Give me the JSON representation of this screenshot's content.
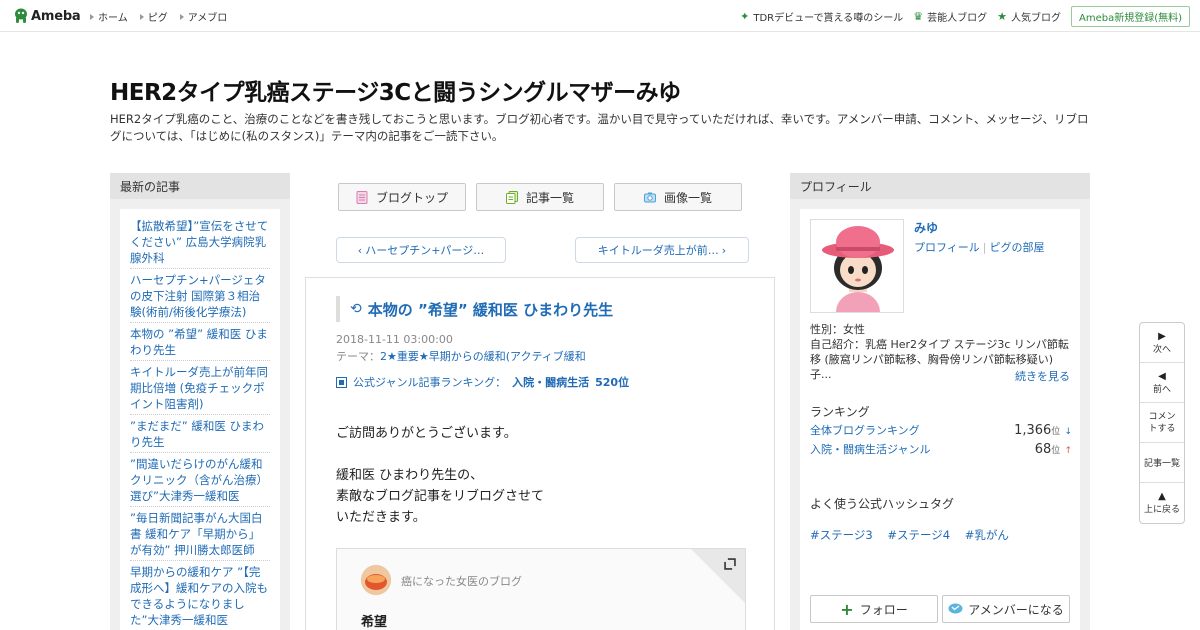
{
  "topbar": {
    "logo_text": "Ameba",
    "nav": [
      "ホーム",
      "ピグ",
      "アメブロ"
    ],
    "links": [
      {
        "label": "TDRデビューで貰える噂のシール",
        "icon": "sparkle-icon"
      },
      {
        "label": "芸能人ブログ",
        "icon": "crown-icon"
      },
      {
        "label": "人気ブログ",
        "icon": "star-icon"
      }
    ],
    "signup": "Ameba新規登録(無料)"
  },
  "header": {
    "title": "HER2タイプ乳癌ステージ3Cと闘うシングルマザーみゆ",
    "description": "HER2タイプ乳癌のこと、治療のことなどを書き残しておこうと思います。ブログ初心者です。温かい目で見守っていただければ、幸いです。アメンバー申請、コメント、メッセージ、リブログについては、「はじめに(私のスタンス)」テーマ内の記事をご一読下さい。"
  },
  "recent": {
    "heading": "最新の記事",
    "items": [
      "【拡散希望】”宣伝をさせてください” 広島大学病院乳腺外科",
      "ハーセプチン+パージェタの皮下注射 国際第３相治験(術前/術後化学療法)",
      "本物の ”希望” 緩和医 ひまわり先生",
      "キイトルーダ売上が前年同期比倍増 (免疫チェックポイント阻害剤)",
      "”まだまだ” 緩和医 ひまわり先生",
      "”間違いだらけのがん緩和クリニック（含がん治療）選び”大津秀一緩和医",
      "”毎日新聞記事がん大国白書 緩和ケア「早期から」が有効” 押川勝太郎医師",
      "早期からの緩和ケア ”【完成形へ】緩和ケアの入院もできるようになりました”大津秀一緩和医"
    ]
  },
  "tabs": {
    "top": "ブログトップ",
    "list": "記事一覧",
    "images": "画像一覧"
  },
  "pager": {
    "prev": "ハーセプチン+パージ…",
    "next": "キイトルーダ売上が前…"
  },
  "article": {
    "title": "本物の ”希望” 緩和医 ひまわり先生",
    "date": "2018-11-11 03:00:00",
    "theme_label": "テーマ：",
    "theme": "2★重要★早期からの緩和(アクティブ緩和",
    "rank_label": "公式ジャンル記事ランキング：",
    "rank_genre": "入院・闘病生活",
    "rank_value": "520位",
    "body": [
      "ご訪問ありがとうございます。",
      "",
      "緩和医 ひまわり先生の、",
      "素敵なブログ記事をリブログさせて",
      "いただきます。"
    ],
    "embed_blog": "癌になった女医のブログ",
    "embed_title": "希望"
  },
  "profile": {
    "heading": "プロフィール",
    "name": "みゆ",
    "link_profile": "プロフィール",
    "link_pig": "ピグの部屋",
    "gender": "性別：女性",
    "intro": "自己紹介：乳癌 Her2タイプ ステージ3c リンパ節転移 (腋窩リンパ節転移、胸骨傍リンパ節転移疑い) 子...",
    "see_more": "続きを見る",
    "ranking_heading": "ランキング",
    "rank_overall_label": "全体ブログランキング",
    "rank_overall_value": "1,366",
    "rank_genre_label": "入院・闘病生活ジャンル",
    "rank_genre_value": "68",
    "rank_unit": "位",
    "hashtag_heading": "よく使う公式ハッシュタグ",
    "hashtags": [
      "#ステージ3",
      "#ステージ4",
      "#乳がん"
    ],
    "follow": "フォロー",
    "amember": "アメンバーになる"
  },
  "sidenav": {
    "next": "次へ",
    "prev": "前へ",
    "comment": "コメントする",
    "list": "記事一覧",
    "top": "上に戻る"
  },
  "colors": {
    "link": "#1f6bb6",
    "ameba_green": "#2d8c3c"
  }
}
